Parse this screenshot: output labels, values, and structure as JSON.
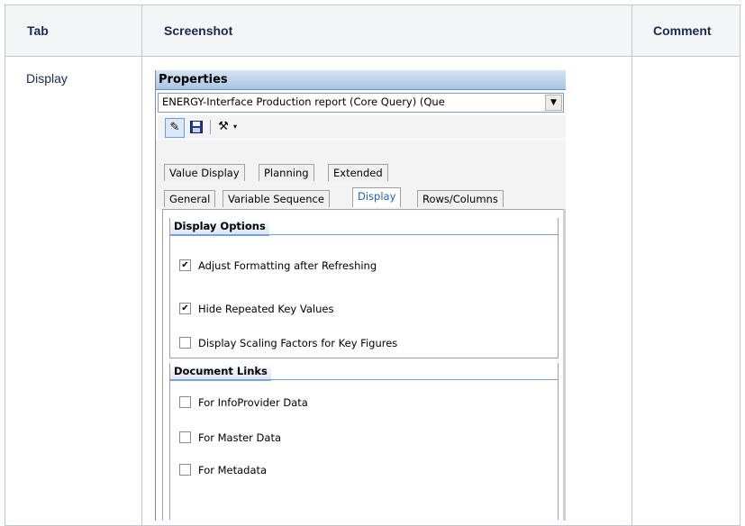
{
  "table": {
    "headers": {
      "tab": "Tab",
      "screenshot": "Screenshot",
      "comment": "Comment"
    },
    "row": {
      "tab": "Display",
      "comment": ""
    }
  },
  "panel": {
    "title": "Properties",
    "query_value": "ENERGY-Interface Production report (Core Query) (Que",
    "dropdown_icon": "triangle-down",
    "toolbar": {
      "buttons": [
        {
          "name": "edit",
          "icon": "pencil-icon",
          "glyph": "✎"
        },
        {
          "name": "save",
          "icon": "floppy-disk-icon",
          "glyph": "💾"
        },
        {
          "name": "tools",
          "icon": "tools-icon",
          "glyph": "⚒"
        }
      ],
      "arrow": "▾"
    },
    "tabs_row1": [
      "Value Display",
      "Planning",
      "Extended"
    ],
    "tabs_row2": [
      "General",
      "Variable Sequence",
      "Display",
      "Rows/Columns"
    ],
    "active_tab": "Display",
    "display_options": {
      "header": "Display Options",
      "items": [
        {
          "label": "Adjust Formatting after Refreshing",
          "checked": true
        },
        {
          "label": "Hide Repeated Key Values",
          "checked": true
        },
        {
          "label": "Display Scaling Factors for Key Figures",
          "checked": false
        }
      ]
    },
    "document_links": {
      "header": "Document Links",
      "items": [
        {
          "label": "For InfoProvider Data",
          "checked": false
        },
        {
          "label": "For Master Data",
          "checked": false
        },
        {
          "label": "For Metadata",
          "checked": false
        }
      ]
    },
    "check_glyph": "✔"
  }
}
